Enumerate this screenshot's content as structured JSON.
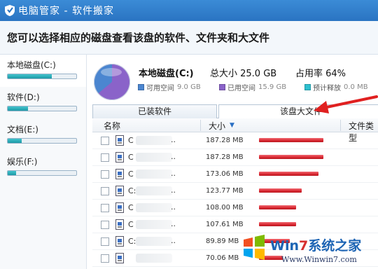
{
  "window": {
    "title": "电脑管家 - 软件搬家"
  },
  "header": {
    "text": "您可以选择相应的磁盘查看该盘的软件、文件夹和大文件"
  },
  "sidebar": {
    "drives": [
      {
        "label": "本地磁盘(C:)",
        "usage": 0.64
      },
      {
        "label": "软件(D:)",
        "usage": 0.3
      },
      {
        "label": "文档(E:)",
        "usage": 0.2
      },
      {
        "label": "娱乐(F:)",
        "usage": 0.12
      }
    ]
  },
  "drive_info": {
    "name": "本地磁盘(C:)",
    "total": "总大小 25.0 GB",
    "usage_rate": "占用率 64%",
    "legend": {
      "free_label": "可用空间",
      "free_value": "9.0 GB",
      "used_label": "已用空间",
      "used_value": "15.9 GB",
      "release_label": "预计释放",
      "release_value": "0.0 MB"
    },
    "colors": {
      "free": "#4b86d0",
      "used": "#8a63c9",
      "release": "#2ec0cf"
    }
  },
  "tabs": [
    {
      "label": "已装软件"
    },
    {
      "label": "该盘大文件"
    }
  ],
  "table": {
    "headers": {
      "name": "名称",
      "size": "大小",
      "type": "文件类型"
    },
    "rows": [
      {
        "name": "C",
        "dots": "..",
        "size": "187.28 MB",
        "bytes_mb": 187.28
      },
      {
        "name": "C",
        "dots": "..",
        "size": "187.28 MB",
        "bytes_mb": 187.28
      },
      {
        "name": "C",
        "dots": "..",
        "size": "173.06 MB",
        "bytes_mb": 173.06
      },
      {
        "name": "C:",
        "dots": "..",
        "size": "123.77 MB",
        "bytes_mb": 123.77
      },
      {
        "name": "C",
        "dots": "..",
        "size": "108.00 MB",
        "bytes_mb": 108.0
      },
      {
        "name": "C",
        "dots": "..",
        "size": "107.61 MB",
        "bytes_mb": 107.61
      },
      {
        "name": "C:",
        "dots": "..",
        "size": "89.89 MB",
        "bytes_mb": 89.89
      },
      {
        "name": "",
        "dots": "",
        "size": "70.06 MB",
        "bytes_mb": 70.06
      }
    ]
  },
  "watermark": {
    "brand_a": "Win",
    "brand_b": "7",
    "brand_c": "系统之家",
    "url": "Www.Winwin7.com"
  }
}
